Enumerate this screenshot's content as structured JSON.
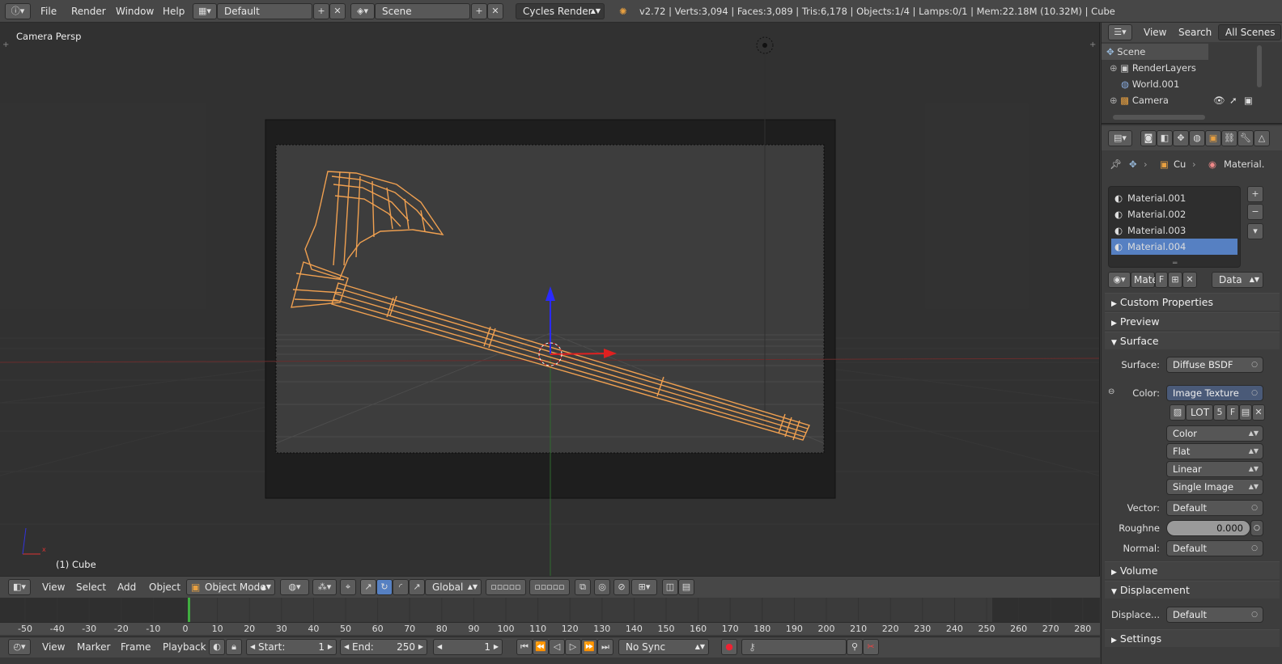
{
  "topbar": {
    "menus": [
      "File",
      "Render",
      "Window",
      "Help"
    ],
    "layout": "Default",
    "scene": "Scene",
    "engine": "Cycles Render",
    "stats": "v2.72 | Verts:3,094 | Faces:3,089 | Tris:6,178 | Objects:1/4 | Lamps:0/1 | Mem:22.18M (10.32M) | Cube"
  },
  "viewport": {
    "view_label": "Camera Persp",
    "object_label": "(1) Cube"
  },
  "view_header": {
    "menus": [
      "View",
      "Select",
      "Add",
      "Object"
    ],
    "mode": "Object Mode",
    "orientation": "Global"
  },
  "timeline": {
    "ticks": [
      "-50",
      "-40",
      "-30",
      "-20",
      "-10",
      "0",
      "10",
      "20",
      "30",
      "40",
      "50",
      "60",
      "70",
      "80",
      "90",
      "100",
      "110",
      "120",
      "130",
      "140",
      "150",
      "160",
      "170",
      "180",
      "190",
      "200",
      "210",
      "220",
      "230",
      "240",
      "250",
      "260",
      "270",
      "280"
    ],
    "menus": [
      "View",
      "Marker",
      "Frame",
      "Playback"
    ],
    "start_label": "Start:",
    "start_value": "1",
    "end_label": "End:",
    "end_value": "250",
    "current_frame": "1",
    "sync": "No Sync"
  },
  "outliner": {
    "menus": [
      "View",
      "Search",
      "All Scenes"
    ],
    "items": [
      "Scene",
      "RenderLayers",
      "World.001",
      "Camera"
    ]
  },
  "properties": {
    "breadcrumb_object": "Cu",
    "breadcrumb_material": "Material.",
    "materials": [
      "Material.001",
      "Material.002",
      "Material.003",
      "Material.004"
    ],
    "selected_material": "Material.004",
    "mat_name": "Mate",
    "mat_fake": "F",
    "link": "Data",
    "sections": {
      "custom_properties": "Custom Properties",
      "preview": "Preview",
      "surface": "Surface",
      "volume": "Volume",
      "displacement": "Displacement",
      "settings": "Settings"
    },
    "surface_label": "Surface:",
    "surface_value": "Diffuse BSDF",
    "color_label": "Color:",
    "color_value": "Image Texture",
    "image_name": "LOT",
    "image_users": "5",
    "image_fake": "F",
    "color_space": "Color",
    "projection": "Flat",
    "interpolation": "Linear",
    "source": "Single Image",
    "vector_label": "Vector:",
    "vector_value": "Default",
    "roughness_label": "Roughne",
    "roughness_value": "0.000",
    "normal_label": "Normal:",
    "normal_value": "Default",
    "displacement_label": "Displace...",
    "displacement_value": "Default"
  }
}
